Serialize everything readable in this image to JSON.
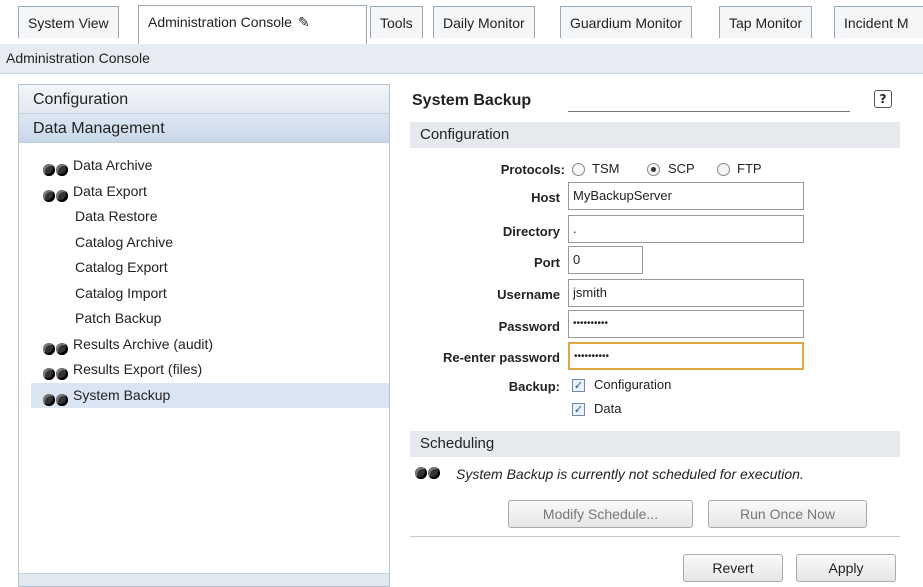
{
  "tabs": [
    {
      "label": "System View"
    },
    {
      "label": "Administration Console"
    },
    {
      "label": "Tools"
    },
    {
      "label": "Daily Monitor"
    },
    {
      "label": "Guardium Monitor"
    },
    {
      "label": "Tap Monitor"
    },
    {
      "label": "Incident M"
    }
  ],
  "active_tab_index": 1,
  "breadcrumb": "Administration Console",
  "sidebar": {
    "sections": {
      "configuration": "Configuration",
      "data_management": "Data Management"
    },
    "items": [
      {
        "label": "Data Archive"
      },
      {
        "label": "Data Export"
      },
      {
        "label": "Data Restore"
      },
      {
        "label": "Catalog Archive"
      },
      {
        "label": "Catalog Export"
      },
      {
        "label": "Catalog Import"
      },
      {
        "label": "Patch Backup"
      },
      {
        "label": "Results Archive (audit)"
      },
      {
        "label": "Results Export (files)"
      },
      {
        "label": "System Backup"
      }
    ]
  },
  "panel": {
    "title": "System Backup",
    "help": "?",
    "configuration_header": "Configuration",
    "protocols_label": "Protocols:",
    "protocol_options": [
      "TSM",
      "SCP",
      "FTP"
    ],
    "protocol_selected": "SCP",
    "host_label": "Host",
    "host_value": "MyBackupServer",
    "directory_label": "Directory",
    "directory_value": ".",
    "port_label": "Port",
    "port_value": "0",
    "username_label": "Username",
    "username_value": "jsmith",
    "password_label": "Password",
    "password_value": "••••••••••",
    "reenter_label": "Re-enter password",
    "reenter_value": "••••••••••",
    "backup_label": "Backup:",
    "backup_config": "Configuration",
    "backup_data": "Data",
    "scheduling_header": "Scheduling",
    "schedule_note": "System Backup is currently not scheduled for execution.",
    "modify_schedule": "Modify Schedule...",
    "run_once": "Run Once Now",
    "revert": "Revert",
    "apply": "Apply"
  }
}
